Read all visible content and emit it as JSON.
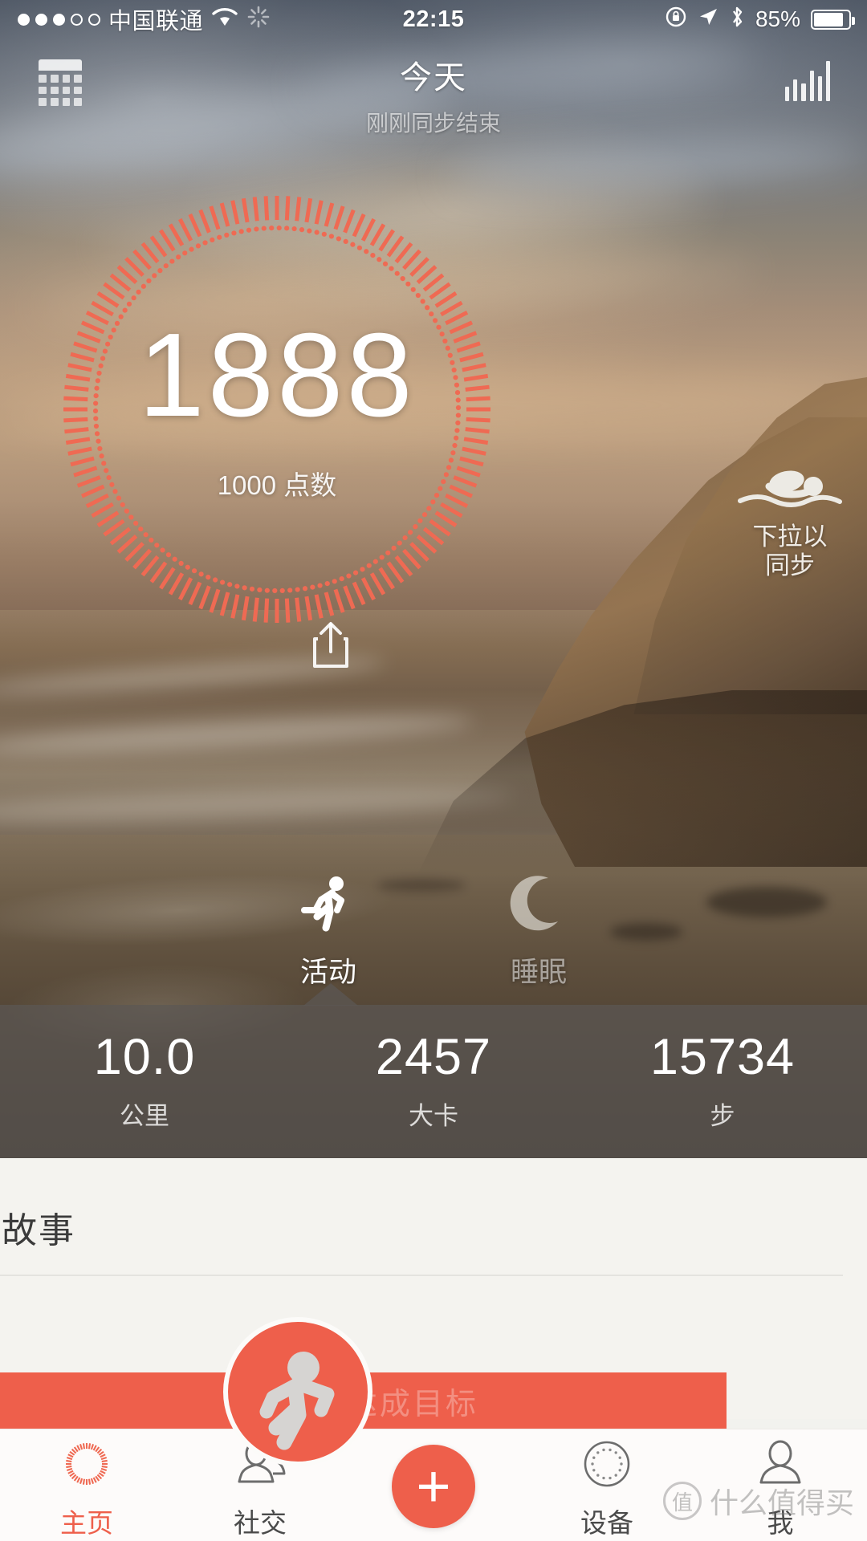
{
  "status_bar": {
    "signal_dots_filled": 3,
    "signal_dots_total": 5,
    "carrier": "中国联通",
    "wifi_icon": "wifi-icon",
    "sync_icon": "activity-spinner-icon",
    "time": "22:15",
    "rotation_lock_icon": "rotation-lock-icon",
    "location_icon": "location-arrow-icon",
    "bluetooth_icon": "bluetooth-icon",
    "battery_percent": "85%",
    "battery_level": 85
  },
  "navbar": {
    "calendar_icon": "calendar-icon",
    "title": "今天",
    "subtitle": "刚刚同步结束",
    "chart_icon": "bar-chart-icon"
  },
  "dial": {
    "value": "1888",
    "goal_label": "1000 点数",
    "share_icon": "share-icon",
    "progress_percent": 100,
    "accent_color": "#ef6a53"
  },
  "pull_sync": {
    "icon": "swimmer-icon",
    "label": "下拉以\n同步",
    "line1": "下拉以",
    "line2": "同步"
  },
  "modes": [
    {
      "id": "activity",
      "label": "活动",
      "icon": "running-icon",
      "active": true
    },
    {
      "id": "sleep",
      "label": "睡眠",
      "icon": "moon-icon",
      "active": false
    }
  ],
  "stats": [
    {
      "value": "10.0",
      "unit": "公里"
    },
    {
      "value": "2457",
      "unit": "大卡"
    },
    {
      "value": "15734",
      "unit": "步"
    }
  ],
  "story": {
    "title": "日故事",
    "banner_text": "150% 达成目标",
    "badge_icon": "runner-badge-icon",
    "banner_color": "#ee5f4b"
  },
  "tabbar": [
    {
      "id": "home",
      "label": "主页",
      "icon": "dial-home-icon",
      "active": true
    },
    {
      "id": "social",
      "label": "社交",
      "icon": "people-icon",
      "active": false
    },
    {
      "id": "add",
      "label": "",
      "icon": "plus-icon",
      "active": false
    },
    {
      "id": "device",
      "label": "设备",
      "icon": "dotted-circle-device-icon",
      "active": false
    },
    {
      "id": "me",
      "label": "我",
      "icon": "person-icon",
      "active": false
    }
  ],
  "watermark": {
    "mark": "值",
    "text": "什么值得买"
  }
}
